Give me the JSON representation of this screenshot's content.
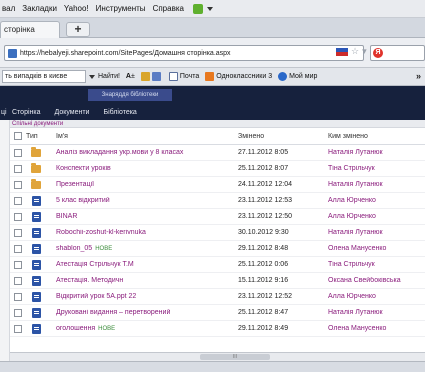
{
  "menu": {
    "items": [
      "вал",
      "Закладки",
      "Yahoo!",
      "Инструменты",
      "Справка"
    ]
  },
  "tab": {
    "title": "сторінка"
  },
  "address": {
    "url": "https://hebalyeji.sharepoint.com/SitePages/Домашня сторінка.aspx"
  },
  "bookmarks": {
    "search_value": "ть випадків в києве",
    "find_label": "Найти!",
    "mail_label": "Почта",
    "ok_label": "Одноклассники 3",
    "moimir_label": "Мой мир",
    "more": "»"
  },
  "ribbon": {
    "group_label": "Знаряддя бібліотеки",
    "edge_label": "ці",
    "tabs": [
      "Сторінка",
      "Документи",
      "Бібліотека"
    ]
  },
  "library": {
    "section_title": "Спільні документи",
    "columns": {
      "type": "Тип",
      "name": "Ім'я",
      "modified": "Змінено",
      "modified_by": "Ким змінено"
    },
    "rows": [
      {
        "icon": "folder",
        "name": "Аналіз викладання укр.мови у 8 класах",
        "date": "27.11.2012 8:05",
        "user": "Наталія Лутанюк",
        "badge": ""
      },
      {
        "icon": "folder",
        "name": "Конспекти уроків",
        "date": "25.11.2012 8:07",
        "user": "Тіна Стрільчук",
        "badge": ""
      },
      {
        "icon": "folder",
        "name": "Презентації",
        "date": "24.11.2012 12:04",
        "user": "Наталія Лутанюк",
        "badge": ""
      },
      {
        "icon": "docx",
        "name": "5 клас відкритий",
        "date": "23.11.2012 12:53",
        "user": "Алла Юрченко",
        "badge": ""
      },
      {
        "icon": "docx",
        "name": "BINAR",
        "date": "23.11.2012 12:50",
        "user": "Алла Юрченко",
        "badge": ""
      },
      {
        "icon": "docx",
        "name": "Robochii-zoshut-kl-kerivnuka",
        "date": "30.10.2012 9:30",
        "user": "Наталія Лутанюк",
        "badge": ""
      },
      {
        "icon": "docx",
        "name": "shablon_05",
        "date": "29.11.2012 8:48",
        "user": "Олена Манусенко",
        "badge": "НОВЕ"
      },
      {
        "icon": "docx",
        "name": "Атестація Стрільчук Т.М",
        "date": "25.11.2012 0:06",
        "user": "Тіна Стрільчук",
        "badge": ""
      },
      {
        "icon": "docx",
        "name": "Атестація. Методичн",
        "date": "15.11.2012 9:16",
        "user": "Оксана Свейбоківська",
        "badge": ""
      },
      {
        "icon": "docx",
        "name": "Відкритий урок 5А.ppt 22",
        "date": "23.11.2012 12:52",
        "user": "Алла Юрченко",
        "badge": ""
      },
      {
        "icon": "docx",
        "name": "Друковані видання – перетворений",
        "date": "25.11.2012 8:47",
        "user": "Наталія Лутанюк",
        "badge": ""
      },
      {
        "icon": "docx",
        "name": "оголошення",
        "date": "29.11.2012 8:49",
        "user": "Олена Манусенко",
        "badge": "НОВЕ"
      }
    ]
  },
  "scrollbar": {
    "grip": "III"
  }
}
